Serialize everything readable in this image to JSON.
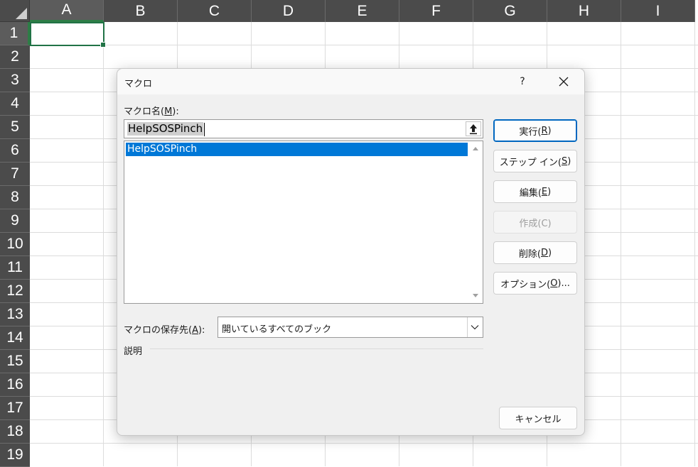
{
  "sheet": {
    "columns": [
      "A",
      "B",
      "C",
      "D",
      "E",
      "F",
      "G",
      "H",
      "I"
    ],
    "rows": [
      "1",
      "2",
      "3",
      "4",
      "5",
      "6",
      "7",
      "8",
      "9",
      "10",
      "11",
      "12",
      "13",
      "14",
      "15",
      "16",
      "17",
      "18",
      "19"
    ]
  },
  "dialog": {
    "title": "マクロ",
    "help_label": "?",
    "macro_name_label": "マクロ名(",
    "macro_name_key": "M",
    "macro_name_suffix": "):",
    "macro_name_value": "HelpSOSPinch",
    "macro_list": [
      "HelpSOSPinch"
    ],
    "buttons": {
      "run": {
        "text": "実行(",
        "key": "R",
        "suffix": ")"
      },
      "step_in": {
        "text": "ステップ イン(",
        "key": "S",
        "suffix": ")"
      },
      "edit": {
        "text": "編集(",
        "key": "E",
        "suffix": ")"
      },
      "create": {
        "label": "作成(C)"
      },
      "delete": {
        "text": "削除(",
        "key": "D",
        "suffix": ")"
      },
      "options": {
        "text": "オプション(",
        "key": "O",
        "suffix": ")..."
      },
      "cancel": {
        "label": "キャンセル"
      }
    },
    "macros_in_label": "マクロの保存先(",
    "macros_in_key": "A",
    "macros_in_suffix": "):",
    "macros_in_value": "開いているすべてのブック",
    "description_label": "説明"
  },
  "colors": {
    "header_bg": "#4b4b4b",
    "selection_green": "#217346",
    "list_selection": "#0078d7",
    "primary_border": "#0067c0"
  }
}
